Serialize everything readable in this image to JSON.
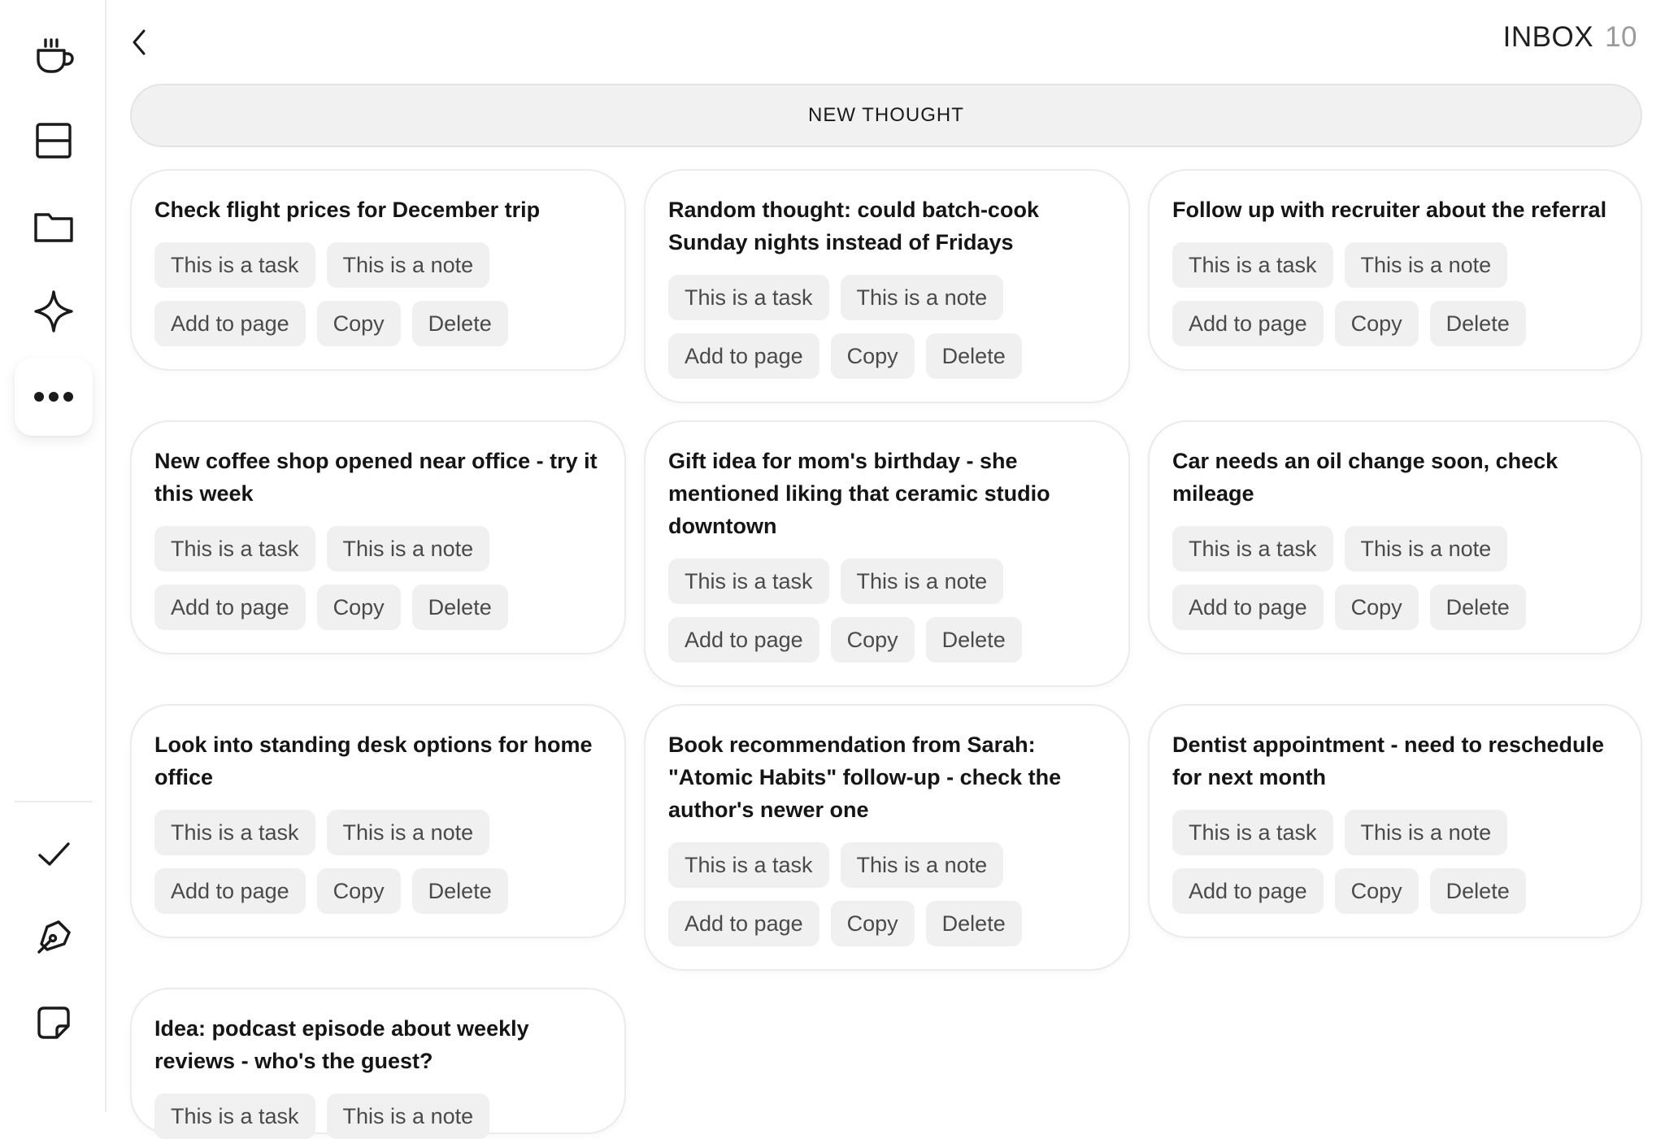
{
  "sidebar": {
    "top_items": [
      {
        "name": "cup-icon"
      },
      {
        "name": "layout-rows-icon"
      },
      {
        "name": "folder-icon"
      },
      {
        "name": "sparkle-icon"
      },
      {
        "name": "more-dots-icon",
        "active": true
      }
    ],
    "bottom_items": [
      {
        "name": "check-icon"
      },
      {
        "name": "pen-nib-icon"
      },
      {
        "name": "sticky-note-icon"
      }
    ]
  },
  "header": {
    "title": "INBOX",
    "count": "10"
  },
  "new_thought": {
    "label": "NEW THOUGHT"
  },
  "actions": {
    "task": "This is a task",
    "note": "This is a note",
    "add": "Add to page",
    "copy": "Copy",
    "delete": "Delete"
  },
  "cards": [
    {
      "title": "Check flight prices for December trip"
    },
    {
      "title": "Random thought: could batch-cook Sunday nights instead of Fridays"
    },
    {
      "title": "Follow up with recruiter about the referral"
    },
    {
      "title": "New coffee shop opened near office - try it this week"
    },
    {
      "title": "Gift idea for mom's birthday - she mentioned liking that ceramic studio downtown"
    },
    {
      "title": "Car needs an oil change soon, check mileage"
    },
    {
      "title": "Look into standing desk options for home office"
    },
    {
      "title": "Book recommendation from Sarah: \"Atomic Habits\" follow-up - check the author's newer one"
    },
    {
      "title": "Dentist appointment - need to reschedule for next month"
    },
    {
      "title": "Idea: podcast episode about weekly reviews - who's the guest?"
    }
  ]
}
